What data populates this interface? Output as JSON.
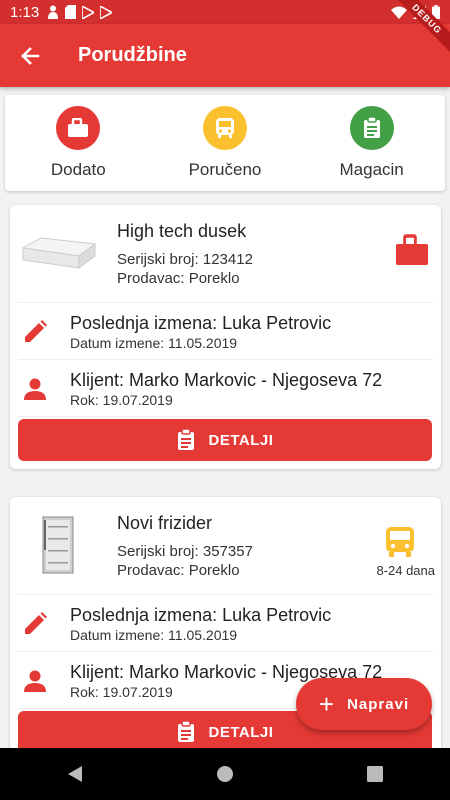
{
  "status_bar": {
    "time": "1:13"
  },
  "app_bar": {
    "title": "Porudžbine",
    "debug_label": "DEBUG"
  },
  "status_filters": [
    {
      "label": "Dodato",
      "icon": "briefcase-icon",
      "color": "#e53935"
    },
    {
      "label": "Poručeno",
      "icon": "bus-icon",
      "color": "#fbc02d"
    },
    {
      "label": "Magacin",
      "icon": "clipboard-icon",
      "color": "#43a047"
    }
  ],
  "orders": [
    {
      "name": "High tech dusek",
      "serial": "Serijski broj: 123412",
      "seller": "Prodavac: Poreklo",
      "status_icon": "briefcase-icon",
      "status_eta": "",
      "last_edit": "Poslednja izmena: Luka Petrovic",
      "edit_date": "Datum izmene: 11.05.2019",
      "client": "Klijent: Marko Markovic - Njegoseva 72",
      "deadline": "Rok: 19.07.2019",
      "details_label": "DETALJI"
    },
    {
      "name": "Novi frizider",
      "serial": "Serijski broj: 357357",
      "seller": "Prodavac: Poreklo",
      "status_icon": "bus-icon",
      "status_eta": "8-24 dana",
      "last_edit": "Poslednja izmena: Luka Petrovic",
      "edit_date": "Datum izmene: 11.05.2019",
      "client": "Klijent: Marko Markovic - Njegoseva 72",
      "deadline": "Rok: 19.07.2019",
      "details_label": "DETALJI"
    }
  ],
  "fab": {
    "label": "Napravi"
  },
  "colors": {
    "primary": "#e53935",
    "status_bar": "#d32f2f",
    "yellow": "#fbc02d",
    "green": "#43a047"
  }
}
